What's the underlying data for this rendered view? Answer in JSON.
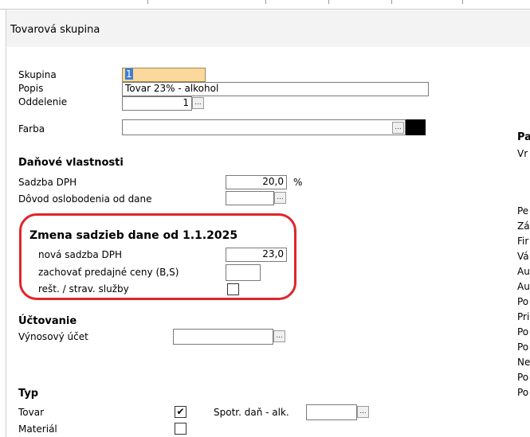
{
  "dialog": {
    "title": "Tovarová skupina"
  },
  "general": {
    "skupina_label": "Skupina",
    "skupina_value": "1",
    "popis_label": "Popis",
    "popis_value": "Tovar 23% - alkohol",
    "oddelenie_label": "Oddelenie",
    "oddelenie_value": "1",
    "farba_label": "Farba",
    "ellipsis": "..."
  },
  "tax": {
    "header": "Daňové vlastnosti",
    "rate_label": "Sadzba DPH",
    "rate_value": "20,0",
    "rate_unit": "%",
    "exempt_label": "Dôvod oslobodenia od dane"
  },
  "rate_change": {
    "header": "Zmena sadzieb dane od 1.1.2025",
    "new_rate_label": "nová sadzba DPH",
    "new_rate_value": "23,0",
    "keep_prices_label": "zachovať predajné ceny (B,S)",
    "restaurant_label": "rešt. / strav. služby"
  },
  "accounting": {
    "header": "Účtovanie",
    "revenue_label": "Výnosový účet"
  },
  "type": {
    "header": "Typ",
    "goods_label": "Tovar",
    "goods_checked": "✔",
    "material_label": "Materiál",
    "excise_label": "Spotr. daň - alk."
  },
  "right_column": {
    "header": "Pa",
    "items": [
      "Vr",
      "Pe",
      "Zá",
      "Fir",
      "Vá",
      "Au",
      "Au",
      "Po",
      "Pri",
      "Po",
      "Po",
      "Ne",
      "Po",
      "Po"
    ]
  }
}
